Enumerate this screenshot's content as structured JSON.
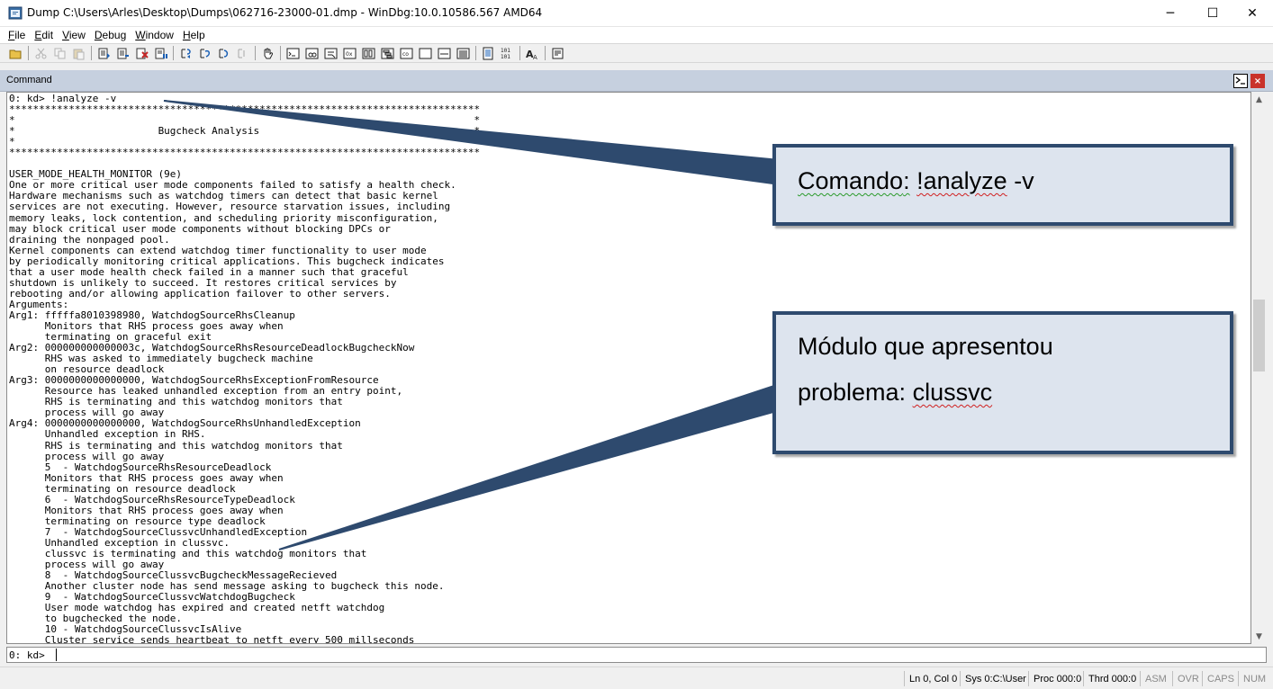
{
  "window": {
    "title": "Dump C:\\Users\\Arles\\Desktop\\Dumps\\062716-23000-01.dmp - WinDbg:10.0.10586.567 AMD64",
    "minimize": "─",
    "maximize": "☐",
    "close": "✕"
  },
  "menu": [
    {
      "u": "F",
      "rest": "ile"
    },
    {
      "u": "E",
      "rest": "dit"
    },
    {
      "u": "V",
      "rest": "iew"
    },
    {
      "u": "D",
      "rest": "ebug"
    },
    {
      "u": "W",
      "rest": "indow"
    },
    {
      "u": "H",
      "rest": "elp"
    }
  ],
  "command_window": {
    "title": "Command",
    "prompt_icon": "command-prompt-icon",
    "close_icon": "×",
    "output": "0: kd> !analyze -v\n*******************************************************************************\n*                                                                             *\n*                        Bugcheck Analysis                                    *\n*                                                                             *\n*******************************************************************************\n\nUSER_MODE_HEALTH_MONITOR (9e)\nOne or more critical user mode components failed to satisfy a health check.\nHardware mechanisms such as watchdog timers can detect that basic kernel\nservices are not executing. However, resource starvation issues, including\nmemory leaks, lock contention, and scheduling priority misconfiguration,\nmay block critical user mode components without blocking DPCs or\ndraining the nonpaged pool.\nKernel components can extend watchdog timer functionality to user mode\nby periodically monitoring critical applications. This bugcheck indicates\nthat a user mode health check failed in a manner such that graceful\nshutdown is unlikely to succeed. It restores critical services by\nrebooting and/or allowing application failover to other servers.\nArguments:\nArg1: fffffa8010398980, WatchdogSourceRhsCleanup\n      Monitors that RHS process goes away when\n      terminating on graceful exit\nArg2: 000000000000003c, WatchdogSourceRhsResourceDeadlockBugcheckNow\n      RHS was asked to immediately bugcheck machine\n      on resource deadlock\nArg3: 0000000000000000, WatchdogSourceRhsExceptionFromResource\n      Resource has leaked unhandled exception from an entry point,\n      RHS is terminating and this watchdog monitors that\n      process will go away\nArg4: 0000000000000000, WatchdogSourceRhsUnhandledException\n      Unhandled exception in RHS.\n      RHS is terminating and this watchdog monitors that\n      process will go away\n      5  - WatchdogSourceRhsResourceDeadlock\n      Monitors that RHS process goes away when\n      terminating on resource deadlock\n      6  - WatchdogSourceRhsResourceTypeDeadlock\n      Monitors that RHS process goes away when\n      terminating on resource type deadlock\n      7  - WatchdogSourceClussvcUnhandledException\n      Unhandled exception in clussvc.\n      clussvc is terminating and this watchdog monitors that\n      process will go away\n      8  - WatchdogSourceClussvcBugcheckMessageRecieved\n      Another cluster node has send message asking to bugcheck this node.\n      9  - WatchdogSourceClussvcWatchdogBugcheck\n      User mode watchdog has expired and created netft watchdog\n      to bugchecked the node.\n      10 - WatchdogSourceClussvcIsAlive\n      Cluster service sends heartbeat to netft every 500 millseconds",
    "input_prompt": "0: kd>",
    "input_value": ""
  },
  "statusbar": {
    "ln_col": "Ln 0, Col 0",
    "sys": "Sys 0:C:\\User",
    "proc": "Proc 000:0",
    "thrd": "Thrd 000:0",
    "asm": "ASM",
    "ovr": "OVR",
    "caps": "CAPS",
    "num": "NUM"
  },
  "callouts": {
    "command": {
      "prefix": "Comando",
      "colon": ":",
      "highlight": "!analyze",
      "suffix": " -v"
    },
    "module": {
      "line1": "Módulo que apresentou",
      "line2_prefix": "problema: ",
      "line2_highlight": "clussvc"
    }
  },
  "colors": {
    "callout_fill": "#dde4ee",
    "callout_border": "#2e4a6e",
    "header_bar": "#c6d0df"
  }
}
